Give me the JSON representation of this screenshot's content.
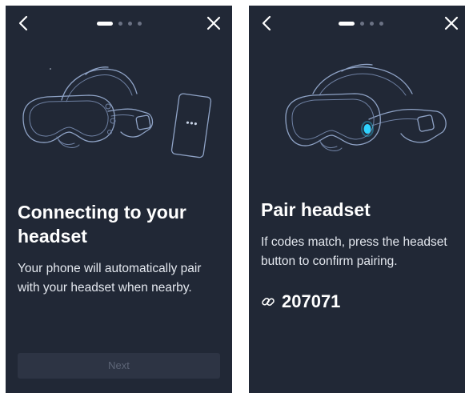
{
  "screen1": {
    "title": "Connecting to your headset",
    "body": "Your phone will automatically pair with your headset when nearby.",
    "next_label": "Next",
    "progress": {
      "current": 1,
      "total": 4
    }
  },
  "screen2": {
    "title": "Pair headset",
    "body": "If codes match, press the headset button to confirm pairing.",
    "code": "207071",
    "progress": {
      "current": 1,
      "total": 4
    }
  },
  "icons": {
    "back": "chevron-left-icon",
    "close": "close-icon",
    "link": "link-icon"
  },
  "colors": {
    "background": "#212836",
    "text": "#ffffff",
    "accent_led": "#2fd3ff",
    "button_disabled": "#2d3444"
  }
}
